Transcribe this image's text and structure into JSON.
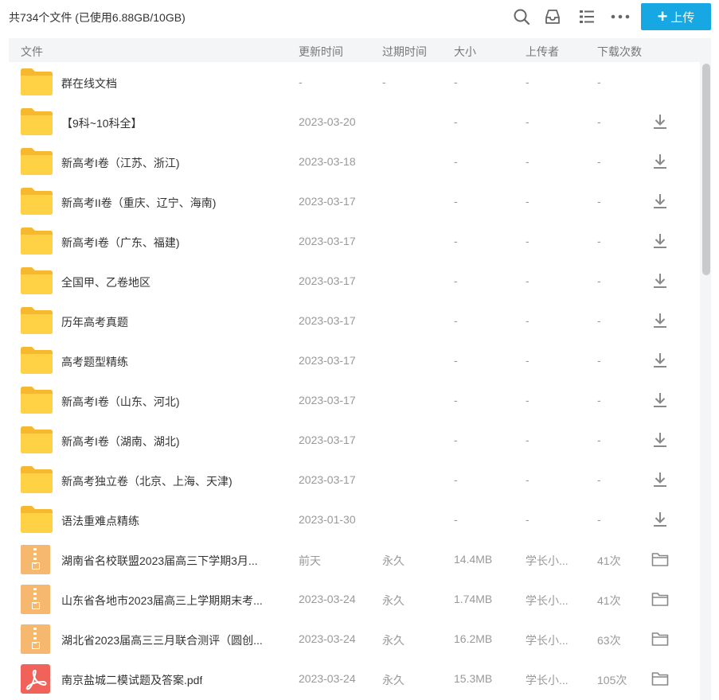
{
  "toolbar": {
    "file_count": "共734个文件 (已使用6.88GB/10GB)",
    "upload_label": "上传",
    "icons": [
      "search-icon",
      "inbox-icon",
      "list-view-icon",
      "more-icon",
      "plus-icon"
    ],
    "accent_color": "#17a8e3"
  },
  "columns": {
    "name": "文件",
    "updated": "更新时间",
    "expires": "过期时间",
    "size": "大小",
    "uploader": "上传者",
    "downloads": "下载次数"
  },
  "files": [
    {
      "type": "folder",
      "name": "群在线文档",
      "updated": "-",
      "expires": "-",
      "size": "-",
      "uploader": "-",
      "downloads": "-",
      "action": ""
    },
    {
      "type": "folder",
      "name": "【9科~10科全】",
      "updated": "2023-03-20",
      "expires": "",
      "size": "-",
      "uploader": "-",
      "downloads": "-",
      "action": "download-icon"
    },
    {
      "type": "folder",
      "name": "新高考I卷（江苏、浙江)",
      "updated": "2023-03-18",
      "expires": "",
      "size": "-",
      "uploader": "-",
      "downloads": "-",
      "action": "download-icon"
    },
    {
      "type": "folder",
      "name": "新高考II卷（重庆、辽宁、海南)",
      "updated": "2023-03-17",
      "expires": "",
      "size": "-",
      "uploader": "-",
      "downloads": "-",
      "action": "download-icon"
    },
    {
      "type": "folder",
      "name": "新高考I卷（广东、福建)",
      "updated": "2023-03-17",
      "expires": "",
      "size": "-",
      "uploader": "-",
      "downloads": "-",
      "action": "download-icon"
    },
    {
      "type": "folder",
      "name": "全国甲、乙卷地区",
      "updated": "2023-03-17",
      "expires": "",
      "size": "-",
      "uploader": "-",
      "downloads": "-",
      "action": "download-icon"
    },
    {
      "type": "folder",
      "name": "历年高考真题",
      "updated": "2023-03-17",
      "expires": "",
      "size": "-",
      "uploader": "-",
      "downloads": "-",
      "action": "download-icon"
    },
    {
      "type": "folder",
      "name": "高考题型精练",
      "updated": "2023-03-17",
      "expires": "",
      "size": "-",
      "uploader": "-",
      "downloads": "-",
      "action": "download-icon"
    },
    {
      "type": "folder",
      "name": "新高考I卷（山东、河北)",
      "updated": "2023-03-17",
      "expires": "",
      "size": "-",
      "uploader": "-",
      "downloads": "-",
      "action": "download-icon"
    },
    {
      "type": "folder",
      "name": "新高考I卷（湖南、湖北)",
      "updated": "2023-03-17",
      "expires": "",
      "size": "-",
      "uploader": "-",
      "downloads": "-",
      "action": "download-icon"
    },
    {
      "type": "folder",
      "name": "新高考独立卷（北京、上海、天津)",
      "updated": "2023-03-17",
      "expires": "",
      "size": "-",
      "uploader": "-",
      "downloads": "-",
      "action": "download-icon"
    },
    {
      "type": "folder",
      "name": "语法重难点精练",
      "updated": "2023-01-30",
      "expires": "",
      "size": "-",
      "uploader": "-",
      "downloads": "-",
      "action": "download-icon"
    },
    {
      "type": "zip",
      "name": "湖南省名校联盟2023届高三下学期3月...",
      "updated": "前天",
      "expires": "永久",
      "size": "14.4MB",
      "uploader": "学长小...",
      "downloads": "41次",
      "action": "folder-outline-icon"
    },
    {
      "type": "zip",
      "name": "山东省各地市2023届高三上学期期末考...",
      "updated": "2023-03-24",
      "expires": "永久",
      "size": "1.74MB",
      "uploader": "学长小...",
      "downloads": "41次",
      "action": "folder-outline-icon"
    },
    {
      "type": "zip",
      "name": "湖北省2023届高三三月联合测评（圆创...",
      "updated": "2023-03-24",
      "expires": "永久",
      "size": "16.2MB",
      "uploader": "学长小...",
      "downloads": "63次",
      "action": "folder-outline-icon"
    },
    {
      "type": "pdf",
      "name": "南京盐城二模试题及答案.pdf",
      "updated": "2023-03-24",
      "expires": "永久",
      "size": "15.3MB",
      "uploader": "学长小...",
      "downloads": "105次",
      "action": "folder-outline-icon"
    }
  ]
}
